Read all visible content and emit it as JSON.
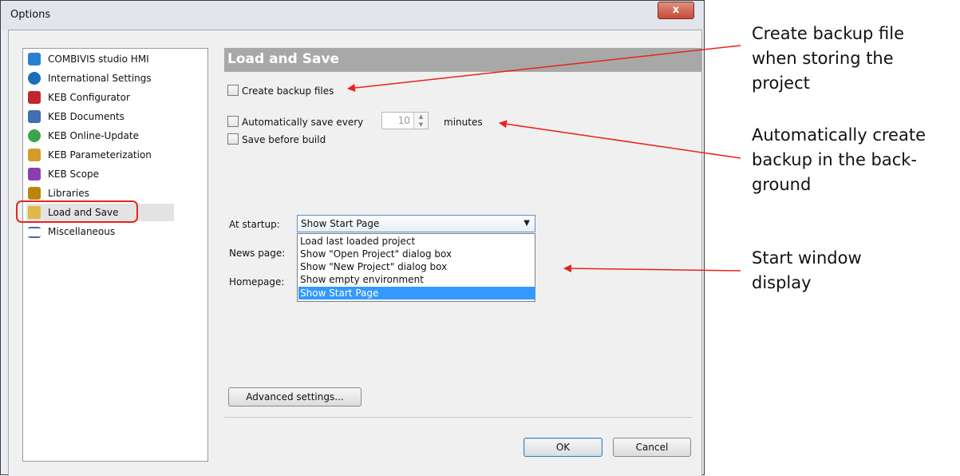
{
  "window": {
    "title": "Options",
    "close_glyph": "x"
  },
  "tree": {
    "items": [
      {
        "label": "COMBIVIS studio HMI",
        "icon": "combivis-icon",
        "color": "#2a7fd4"
      },
      {
        "label": "International Settings",
        "icon": "globe-icon",
        "color": "#1a6fb8"
      },
      {
        "label": "KEB Configurator",
        "icon": "keb-configurator-icon",
        "color": "#c0262d"
      },
      {
        "label": "KEB Documents",
        "icon": "keb-documents-icon",
        "color": "#3f6fb0"
      },
      {
        "label": "KEB Online-Update",
        "icon": "online-update-icon",
        "color": "#3ba34a"
      },
      {
        "label": "KEB Parameterization",
        "icon": "parameterization-icon",
        "color": "#d49b2a"
      },
      {
        "label": "KEB Scope",
        "icon": "scope-icon",
        "color": "#8a3fb0"
      },
      {
        "label": "Libraries",
        "icon": "libraries-icon",
        "color": "#b8860b"
      },
      {
        "label": "Load and Save",
        "icon": "folder-open-icon",
        "color": "#e0b84a"
      },
      {
        "label": "Miscellaneous",
        "icon": "list-icon",
        "color": "#4a6a9a"
      }
    ],
    "selected_index": 8
  },
  "section": {
    "title": "Load and Save"
  },
  "options": {
    "backup_label": "Create backup files",
    "autosave_label": "Automatically save every",
    "autosave_value": "10",
    "autosave_unit": "minutes",
    "save_before_build_label": "Save before build"
  },
  "startup": {
    "label": "At startup:",
    "selected": "Show Start Page",
    "options": [
      "Load last loaded project",
      "Show \"Open Project\" dialog box",
      "Show \"New Project\" dialog box",
      "Show empty environment",
      "Show Start Page"
    ],
    "highlighted_index": 4
  },
  "news_label": "News page:",
  "homepage_label": "Homepage:",
  "buttons": {
    "advanced": "Advanced settings...",
    "ok": "OK",
    "cancel": "Cancel"
  },
  "annotations": {
    "backup": "Create backup file when storing the project",
    "autosave": "Automatically create backup in the back-ground",
    "startup": "Start window display"
  },
  "colors": {
    "annotation_arrow": "#e8231d",
    "selection": "#3399ff",
    "section_header": "#a8a8a8"
  }
}
